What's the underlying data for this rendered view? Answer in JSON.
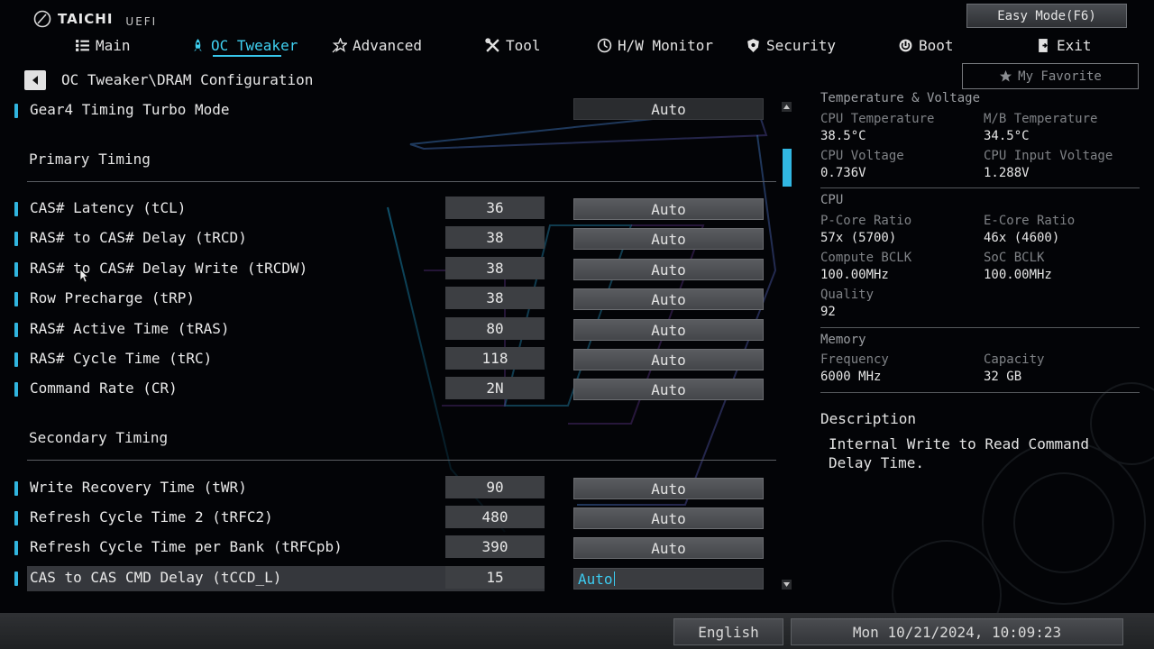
{
  "brand": {
    "logo": "TAICHI",
    "suffix": "UEFI"
  },
  "easy_mode_label": "Easy Mode(F6)",
  "nav": [
    {
      "id": "main",
      "label": "Main",
      "icon": "list-icon"
    },
    {
      "id": "oc",
      "label": "OC Tweaker",
      "icon": "rocket-icon",
      "active": true
    },
    {
      "id": "advanced",
      "label": "Advanced",
      "icon": "star-icon"
    },
    {
      "id": "tool",
      "label": "Tool",
      "icon": "tools-icon"
    },
    {
      "id": "hw",
      "label": "H/W Monitor",
      "icon": "monitor-icon"
    },
    {
      "id": "security",
      "label": "Security",
      "icon": "shield-icon"
    },
    {
      "id": "boot",
      "label": "Boot",
      "icon": "power-icon"
    },
    {
      "id": "exit",
      "label": "Exit",
      "icon": "exit-icon"
    }
  ],
  "favorite_label": "My Favorite",
  "breadcrumb": "OC Tweaker\\DRAM Configuration",
  "settings": {
    "gear4": {
      "label": "Gear4 Timing Turbo Mode",
      "option": "Auto"
    },
    "primary_title": "Primary Timing",
    "primary": [
      {
        "label": "CAS# Latency (tCL)",
        "value": "36",
        "option": "Auto"
      },
      {
        "label": "RAS# to CAS# Delay (tRCD)",
        "value": "38",
        "option": "Auto"
      },
      {
        "label": "RAS# to CAS# Delay Write (tRCDW)",
        "value": "38",
        "option": "Auto"
      },
      {
        "label": "Row Precharge (tRP)",
        "value": "38",
        "option": "Auto"
      },
      {
        "label": "RAS# Active Time (tRAS)",
        "value": "80",
        "option": "Auto"
      },
      {
        "label": "RAS# Cycle Time (tRC)",
        "value": "118",
        "option": "Auto"
      },
      {
        "label": "Command Rate (CR)",
        "value": "2N",
        "option": "Auto"
      }
    ],
    "secondary_title": "Secondary Timing",
    "secondary": [
      {
        "label": "Write Recovery Time (tWR)",
        "value": "90",
        "option": "Auto"
      },
      {
        "label": "Refresh Cycle Time 2 (tRFC2)",
        "value": "480",
        "option": "Auto"
      },
      {
        "label": "Refresh Cycle Time per Bank (tRFCpb)",
        "value": "390",
        "option": "Auto"
      },
      {
        "label": "CAS to CAS CMD Delay (tCCD_L)",
        "value": "15",
        "option": "Auto",
        "selected": true
      }
    ]
  },
  "monitor": {
    "tv_title": "Temperature & Voltage",
    "cpu_temp": {
      "label": "CPU Temperature",
      "value": "38.5°C"
    },
    "mb_temp": {
      "label": "M/B Temperature",
      "value": "34.5°C"
    },
    "cpu_volt": {
      "label": "CPU Voltage",
      "value": "0.736V"
    },
    "cpu_in_volt": {
      "label": "CPU Input Voltage",
      "value": "1.288V"
    },
    "cpu_title": "CPU",
    "pcore": {
      "label": "P-Core Ratio",
      "value": "57x (5700)"
    },
    "ecore": {
      "label": "E-Core Ratio",
      "value": "46x (4600)"
    },
    "bclk": {
      "label": "Compute BCLK",
      "value": "100.00MHz"
    },
    "soc": {
      "label": "SoC BCLK",
      "value": "100.00MHz"
    },
    "quality": {
      "label": "Quality",
      "value": "92"
    },
    "mem_title": "Memory",
    "freq": {
      "label": "Frequency",
      "value": "6000 MHz"
    },
    "cap": {
      "label": "Capacity",
      "value": "32 GB"
    }
  },
  "description": {
    "title": "Description",
    "text": "Internal Write to Read Command Delay Time."
  },
  "footer": {
    "language": "English",
    "datetime": "Mon 10/21/2024, 10:09:23"
  },
  "colors": {
    "accent": "#37c6ea",
    "panel": "#3d3f43",
    "background": "#030407"
  }
}
